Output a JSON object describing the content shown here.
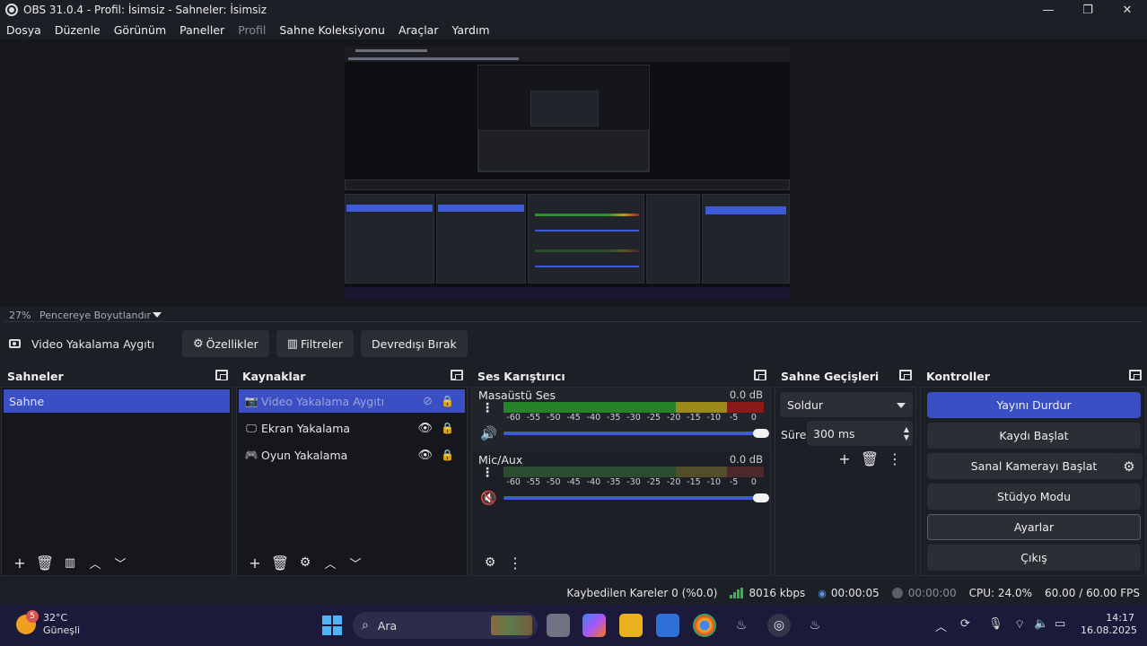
{
  "window": {
    "title": "OBS 31.0.4 - Profil: İsimsiz - Sahneler: İsimsiz",
    "minimize": "—",
    "maximize": "❐",
    "close": "✕"
  },
  "menu": [
    "Dosya",
    "Düzenle",
    "Görünüm",
    "Paneller",
    "Profil",
    "Sahne Koleksiyonu",
    "Araçlar",
    "Yardım"
  ],
  "zoom": {
    "value": "27%",
    "fit_label": "Pencereye Boyutlandır"
  },
  "context": {
    "source_name": "Video Yakalama Aygıtı",
    "properties_label": "Özellikler",
    "filters_label": "Filtreler",
    "deactivate_label": "Devredışı Bırak"
  },
  "scenes": {
    "title": "Sahneler",
    "items": [
      "Sahne"
    ]
  },
  "sources": {
    "title": "Kaynaklar",
    "items": [
      {
        "name": "Video Yakalama Aygıtı",
        "icon": "camera-icon"
      },
      {
        "name": "Ekran Yakalama",
        "icon": "monitor-icon"
      },
      {
        "name": "Oyun Yakalama",
        "icon": "gamepad-icon"
      }
    ]
  },
  "mixer": {
    "title": "Ses Karıştırıcı",
    "ticks": [
      "-60",
      "-55",
      "-50",
      "-45",
      "-40",
      "-35",
      "-30",
      "-25",
      "-20",
      "-15",
      "-10",
      "-5",
      "0"
    ],
    "tracks": [
      {
        "name": "Masaüstü Ses",
        "db": "0.0 dB",
        "muted": false
      },
      {
        "name": "Mic/Aux",
        "db": "0.0 dB",
        "muted": true
      }
    ]
  },
  "transitions": {
    "title": "Sahne Geçişleri",
    "selected": "Soldur",
    "duration_label": "Süre",
    "duration_value": "300 ms"
  },
  "controls": {
    "title": "Kontroller",
    "stop_stream": "Yayını Durdur",
    "start_recording": "Kaydı Başlat",
    "start_virtual_cam": "Sanal Kamerayı Başlat",
    "studio_mode": "Stüdyo Modu",
    "settings": "Ayarlar",
    "exit": "Çıkış"
  },
  "status": {
    "dropped_frames": "Kaybedilen Kareler 0 (%0.0)",
    "bitrate": "8016 kbps",
    "stream_time": "00:00:05",
    "record_time": "00:00:00",
    "cpu": "CPU: 24.0%",
    "fps": "60.00 / 60.00 FPS"
  },
  "taskbar": {
    "weather_badge": "5",
    "temperature": "32°C",
    "weather_desc": "Güneşli",
    "search_placeholder": "Ara",
    "time": "14:17",
    "date": "16.08.2025"
  },
  "colors": {
    "accent": "#3a4fc4",
    "background": "#1d1f26",
    "panel": "#16171c"
  }
}
